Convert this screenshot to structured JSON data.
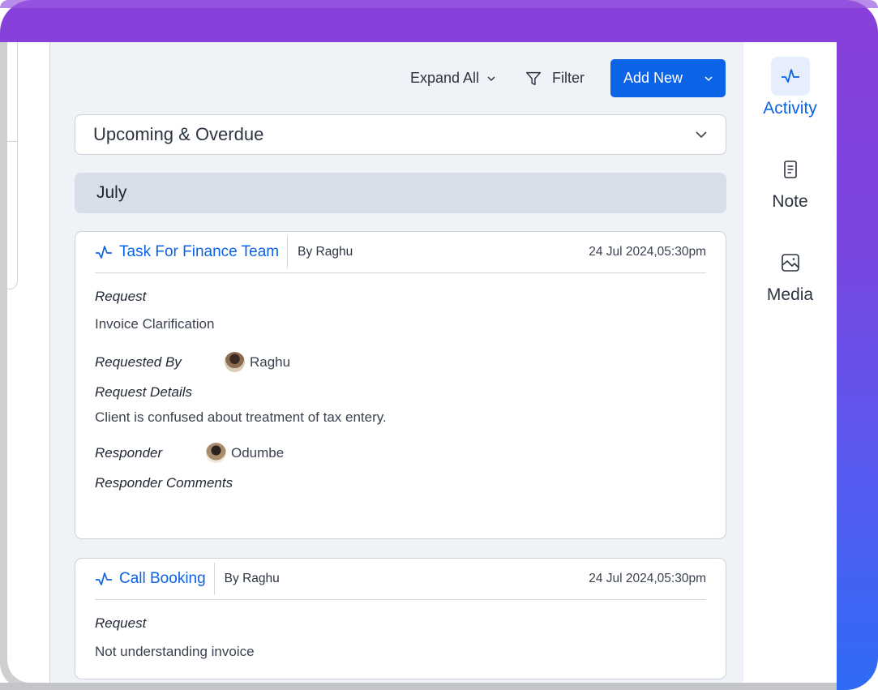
{
  "toolbar": {
    "expand_all_label": "Expand All",
    "filter_label": "Filter",
    "add_new_label": "Add New"
  },
  "filter_select": {
    "selected": "Upcoming & Overdue"
  },
  "month_group": "July",
  "cards": [
    {
      "title": "Task For Finance Team",
      "by": "By Raghu",
      "datetime": "24 Jul 2024,05:30pm",
      "request_label": "Request",
      "request_value": "Invoice Clarification",
      "requested_by_label": "Requested By",
      "requested_by_name": "Raghu",
      "request_details_label": "Request Details",
      "request_details_value": "Client is confused about treatment of tax entery.",
      "responder_label": "Responder",
      "responder_name": "Odumbe",
      "responder_comments_label": "Responder Comments"
    },
    {
      "title": "Call Booking",
      "by": "By Raghu",
      "datetime": "24 Jul 2024,05:30pm",
      "request_label": "Request",
      "request_value": "Not understanding invoice"
    }
  ],
  "sidebar": {
    "items": [
      {
        "label": "Activity",
        "icon": "activity-icon",
        "active": true
      },
      {
        "label": "Note",
        "icon": "note-icon",
        "active": false
      },
      {
        "label": "Media",
        "icon": "image-icon",
        "active": false
      }
    ]
  },
  "colors": {
    "accent": "#0b63e5",
    "month_bar": "#d8deea",
    "panel_bg": "#eff2f7",
    "frame_top": "#8a3fd9",
    "frame_bottom": "#2f6bf5"
  }
}
